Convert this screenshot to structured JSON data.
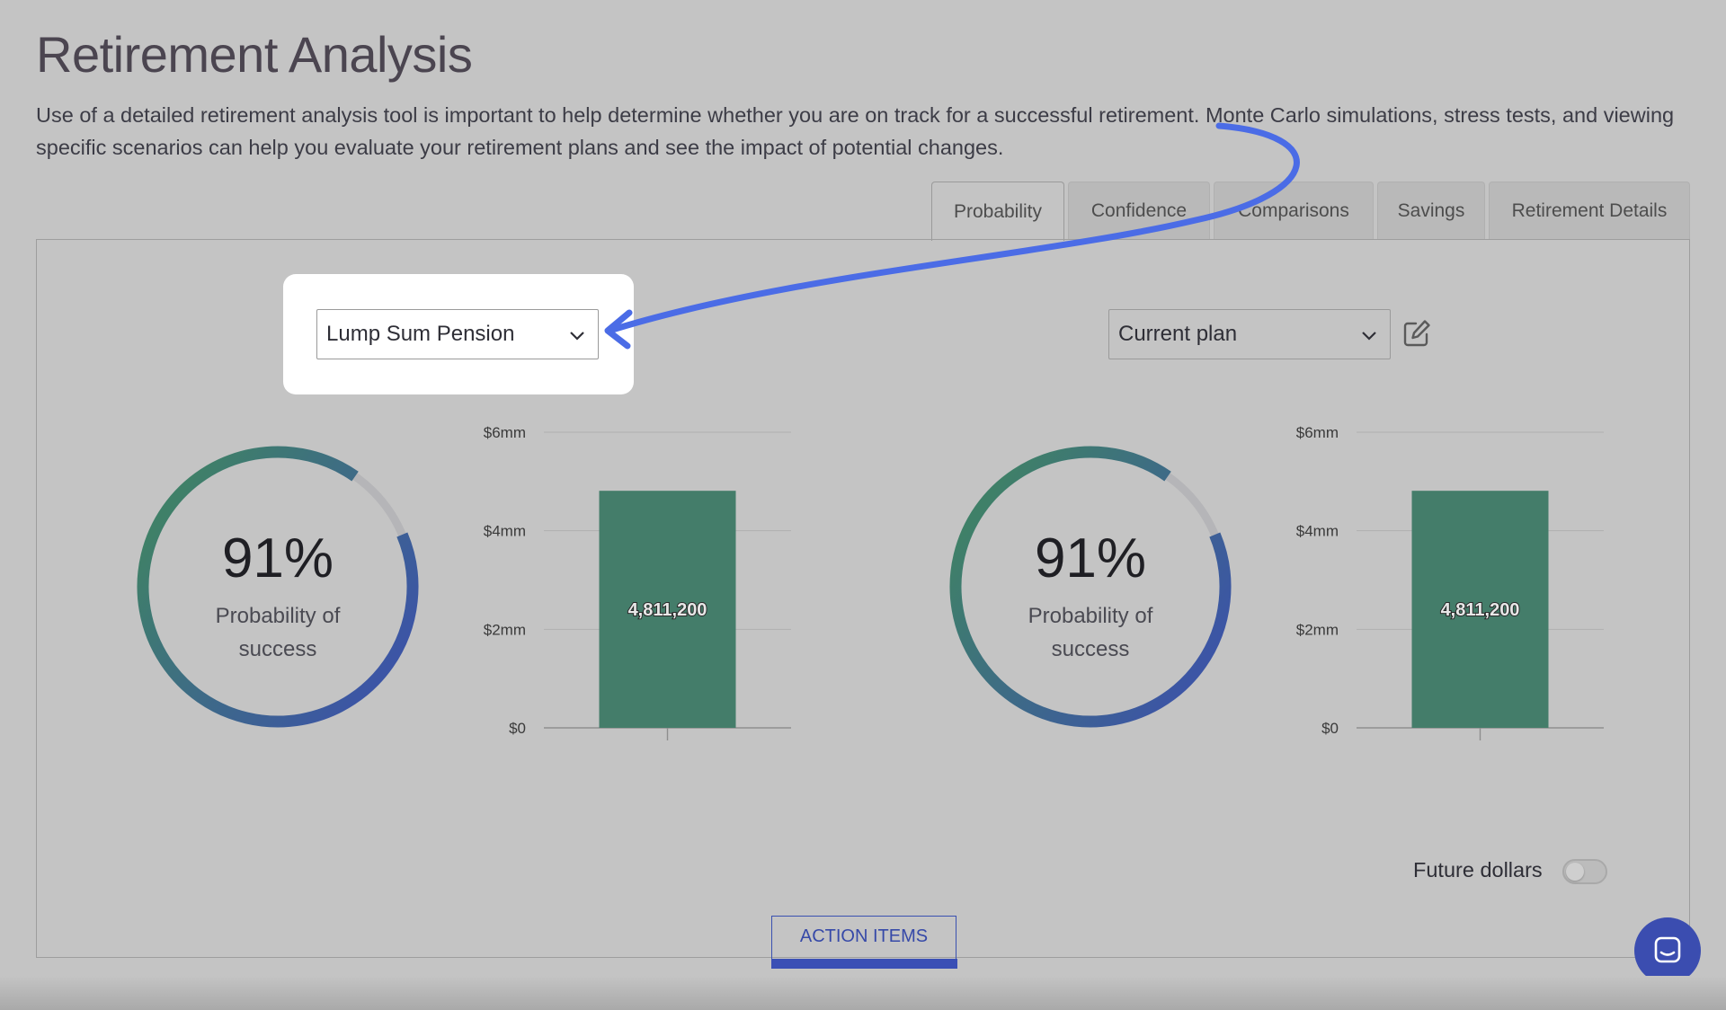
{
  "page": {
    "title": "Retirement Analysis",
    "description": "Use of a detailed retirement analysis tool is important to help determine whether you are on track for a successful retirement. Monte Carlo simulations, stress tests, and viewing specific scenarios can help you evaluate your retirement plans and see the impact of potential changes."
  },
  "tabs": [
    {
      "label": "Probability",
      "active": true
    },
    {
      "label": "Confidence",
      "active": false
    },
    {
      "label": "Comparisons",
      "active": false
    },
    {
      "label": "Savings",
      "active": false
    },
    {
      "label": "Retirement Details",
      "active": false
    }
  ],
  "left": {
    "scenario_select": "Lump Sum Pension",
    "gauge_value": "91%",
    "gauge_label_line1": "Probability of",
    "gauge_label_line2": "success"
  },
  "right": {
    "scenario_select": "Current plan",
    "gauge_value": "91%",
    "gauge_label_line1": "Probability of",
    "gauge_label_line2": "success"
  },
  "future_dollars_label": "Future dollars",
  "future_dollars_on": false,
  "action_items_label": "ACTION ITEMS",
  "colors": {
    "bar": "#447d6a",
    "gauge_top": "#3c55a5",
    "gauge_bottom": "#3f8068",
    "accent": "#3a4fb5",
    "annotation_arrow": "#4b6ce6"
  },
  "chart_data": [
    {
      "type": "bar",
      "categories": [
        ""
      ],
      "values": [
        4811200
      ],
      "data_labels": [
        "4,811,200"
      ],
      "y_ticks": [
        "$0",
        "$2mm",
        "$4mm",
        "$6mm"
      ],
      "ylim": [
        0,
        6000000
      ],
      "probability_of_success": 0.91
    },
    {
      "type": "bar",
      "categories": [
        ""
      ],
      "values": [
        4811200
      ],
      "data_labels": [
        "4,811,200"
      ],
      "y_ticks": [
        "$0",
        "$2mm",
        "$4mm",
        "$6mm"
      ],
      "ylim": [
        0,
        6000000
      ],
      "probability_of_success": 0.91
    }
  ]
}
